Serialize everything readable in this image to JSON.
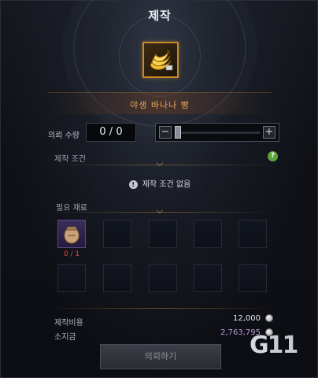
{
  "window": {
    "title": "제작"
  },
  "item": {
    "name": "야생 바나나 빵",
    "icon": "banana-icon"
  },
  "quantity": {
    "label": "의뢰 수량",
    "value": "0 / 0",
    "minus": "−",
    "plus": "+"
  },
  "conditions": {
    "label": "제작 조건",
    "help": "?",
    "info": "!",
    "none_text": "제작 조건 없음"
  },
  "materials": {
    "label": "필요 재료",
    "first_count": "0 / 1",
    "slots": [
      {
        "icon": "sack-icon",
        "filled": true
      },
      {
        "filled": false
      },
      {
        "filled": false
      },
      {
        "filled": false
      },
      {
        "filled": false
      },
      {
        "filled": false
      },
      {
        "filled": false
      },
      {
        "filled": false
      },
      {
        "filled": false
      },
      {
        "filled": false
      }
    ]
  },
  "cost": {
    "label": "제작비용",
    "value": "12,000",
    "value_color": "#e6e8ee"
  },
  "owned": {
    "label": "소지금",
    "value": "2,763,795",
    "value_color": "#b89ad8"
  },
  "request_button": {
    "label": "의뢰하기"
  },
  "watermark": {
    "text_g": "G",
    "text_num": "11"
  },
  "colors": {
    "accent": "#e8a35a",
    "frame": "#c98a2a",
    "error": "#e04444"
  }
}
